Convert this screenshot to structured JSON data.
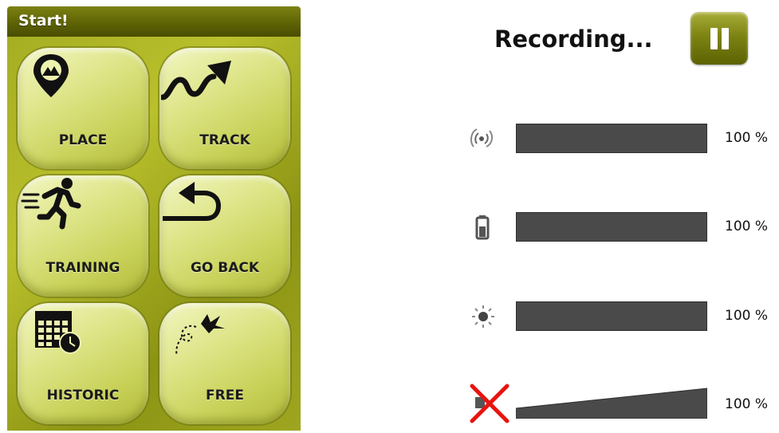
{
  "panel": {
    "title": "Start!",
    "tiles": [
      {
        "label": "PLACE",
        "icon": "map-pin-icon"
      },
      {
        "label": "TRACK",
        "icon": "track-curve-icon"
      },
      {
        "label": "TRAINING",
        "icon": "runner-icon"
      },
      {
        "label": "GO BACK",
        "icon": "return-arrow-icon"
      },
      {
        "label": "HISTORIC",
        "icon": "calendar-clock-icon"
      },
      {
        "label": "FREE",
        "icon": "bird-flight-icon"
      }
    ]
  },
  "status": {
    "title": "Recording...",
    "pause_icon": "pause-icon",
    "meters": [
      {
        "icon": "gps-signal-icon",
        "level_percent": 100,
        "value": "100 %"
      },
      {
        "icon": "battery-icon",
        "level_percent": 100,
        "value": "100 %"
      },
      {
        "icon": "brightness-icon",
        "level_percent": 100,
        "value": "100 %"
      },
      {
        "icon": "volume-muted-icon",
        "level_percent": 100,
        "value": "100 %"
      }
    ]
  },
  "colors": {
    "panel_olive": "#a3ab21",
    "titlebar_dark": "#5e6305",
    "tile_light": "#dfe68c",
    "meter_bar": "#4a4a4a",
    "mute_cross": "#e8130f"
  }
}
